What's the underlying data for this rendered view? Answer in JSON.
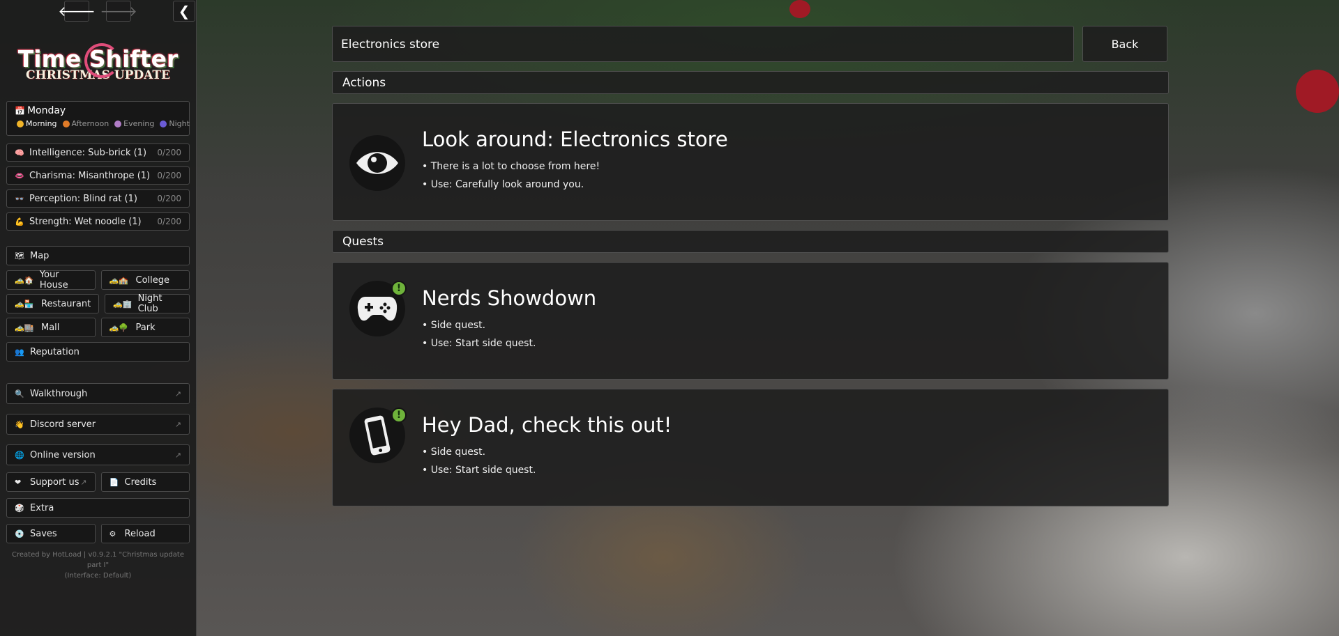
{
  "nav": {
    "back_glyph": "🡐",
    "forward_glyph": "🡒",
    "collapse_glyph": "❮"
  },
  "logo": {
    "line1": "Time Shifter",
    "line2": "CHRISTMAS UPDATE"
  },
  "day": {
    "icon": "calendar-icon",
    "name": "Monday",
    "times": [
      {
        "label": "Morning",
        "color": "#f0b429",
        "active": true
      },
      {
        "label": "Afternoon",
        "color": "#e07b28",
        "active": false
      },
      {
        "label": "Evening",
        "color": "#b07cc6",
        "active": false
      },
      {
        "label": "Night",
        "color": "#6b5cd6",
        "active": false
      }
    ]
  },
  "stats": [
    {
      "icon": "brain-icon",
      "label": "Intelligence: Sub-brick (1)",
      "value": "0/200"
    },
    {
      "icon": "lips-icon",
      "label": "Charisma: Misanthrope (1)",
      "value": "0/200"
    },
    {
      "icon": "glasses-icon",
      "label": "Perception: Blind rat (1)",
      "value": "0/200"
    },
    {
      "icon": "muscle-icon",
      "label": "Strength: Wet noodle (1)",
      "value": "0/200"
    }
  ],
  "menu": {
    "map": "Map",
    "locations": [
      [
        "Your House",
        "College"
      ],
      [
        "Restaurant",
        "Night Club"
      ],
      [
        "Mall",
        "Park"
      ]
    ],
    "reputation": "Reputation",
    "walkthrough": "Walkthrough",
    "discord": "Discord server",
    "online": "Online version",
    "support": "Support us",
    "credits": "Credits",
    "extra": "Extra",
    "saves": "Saves",
    "reload": "Reload"
  },
  "footer": {
    "line1": "Created by HotLoad | v0.9.2.1 \"Christmas update part I\"",
    "line2": "(Interface: Default)"
  },
  "location_title": "Electronics store",
  "back_label": "Back",
  "sections": {
    "actions": "Actions",
    "quests": "Quests"
  },
  "cards": [
    {
      "icon": "eye-icon",
      "title": "Look around: Electronics store",
      "lines": [
        "• There is a lot to choose from here!",
        "• Use: Carefully look around you."
      ],
      "badge": ""
    },
    {
      "icon": "gamepad-icon",
      "title": "Nerds Showdown",
      "lines": [
        "• Side quest.",
        "• Use: Start side quest."
      ],
      "badge": "!"
    },
    {
      "icon": "smartphone-icon",
      "title": "Hey Dad, check this out!",
      "lines": [
        "• Side quest.",
        "• Use: Start side quest."
      ],
      "badge": "!"
    }
  ]
}
